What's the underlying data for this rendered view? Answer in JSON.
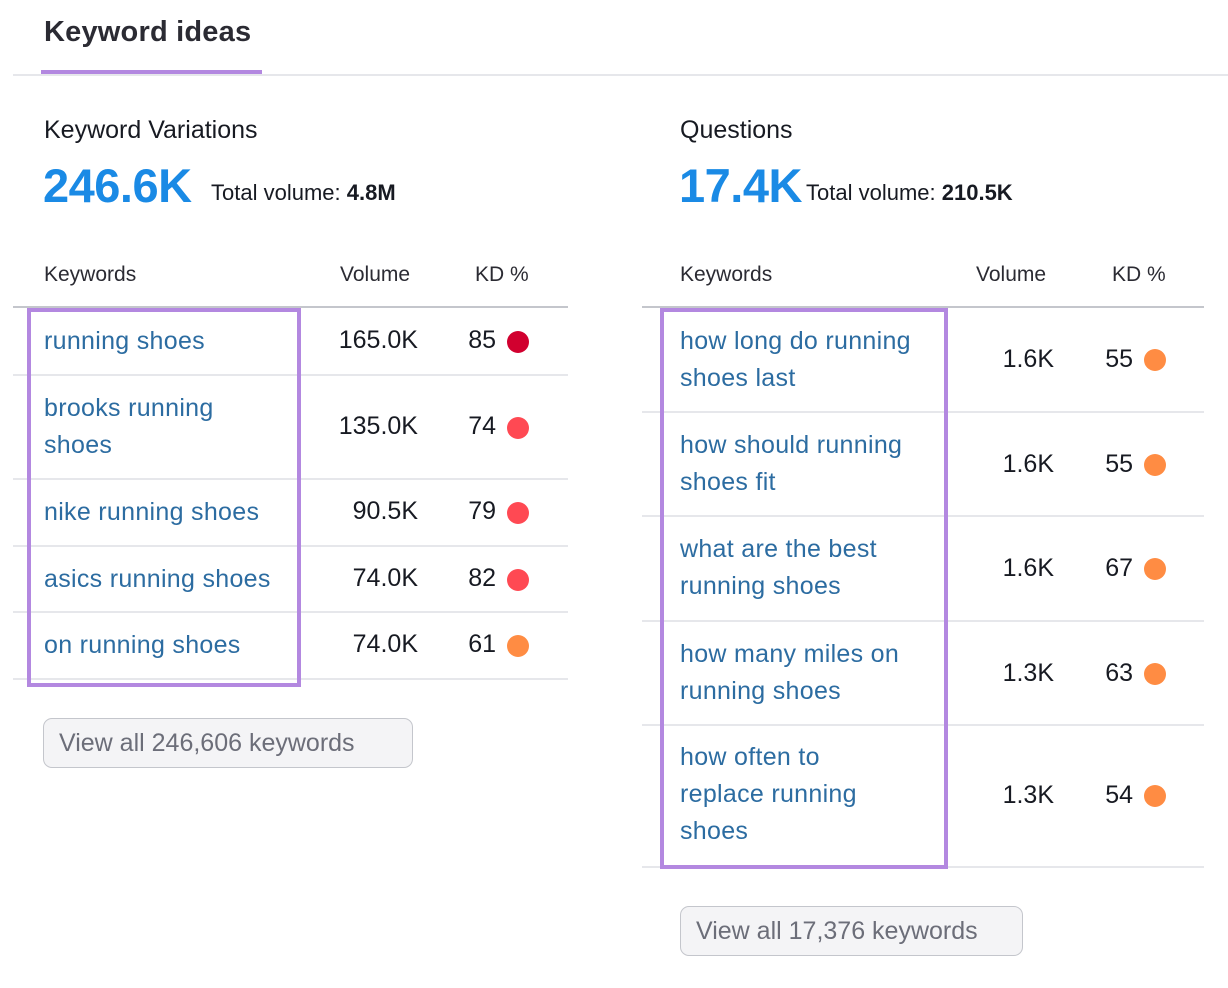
{
  "header": {
    "active_tab": "Keyword ideas"
  },
  "colors": {
    "accent_underline": "#b388e0",
    "big_number": "#1a8ae5",
    "link": "#2c6ca1",
    "kd_very_hard": "#d1002f",
    "kd_hard": "#ff4953",
    "kd_difficult": "#ff8c43"
  },
  "variations": {
    "title": "Keyword Variations",
    "count": "246.6K",
    "total_volume_label": "Total volume:",
    "total_volume_value": "4.8M",
    "columns": {
      "keywords": "Keywords",
      "volume": "Volume",
      "kd": "KD %"
    },
    "rows": [
      {
        "keyword": "running shoes",
        "volume": "165.0K",
        "kd": "85",
        "kd_level": "very-hard"
      },
      {
        "keyword": "brooks running shoes",
        "volume": "135.0K",
        "kd": "74",
        "kd_level": "hard"
      },
      {
        "keyword": "nike running shoes",
        "volume": "90.5K",
        "kd": "79",
        "kd_level": "hard"
      },
      {
        "keyword": "asics running shoes",
        "volume": "74.0K",
        "kd": "82",
        "kd_level": "hard"
      },
      {
        "keyword": "on running shoes",
        "volume": "74.0K",
        "kd": "61",
        "kd_level": "difficult"
      }
    ],
    "view_all_label": "View all 246,606 keywords"
  },
  "questions": {
    "title": "Questions",
    "count": "17.4K",
    "total_volume_label": "Total volume:",
    "total_volume_value": "210.5K",
    "columns": {
      "keywords": "Keywords",
      "volume": "Volume",
      "kd": "KD %"
    },
    "rows": [
      {
        "keyword": "how long do running shoes last",
        "volume": "1.6K",
        "kd": "55",
        "kd_level": "difficult"
      },
      {
        "keyword": "how should running shoes fit",
        "volume": "1.6K",
        "kd": "55",
        "kd_level": "difficult"
      },
      {
        "keyword": "what are the best running shoes",
        "volume": "1.6K",
        "kd": "67",
        "kd_level": "difficult"
      },
      {
        "keyword": "how many miles on running shoes",
        "volume": "1.3K",
        "kd": "63",
        "kd_level": "difficult"
      },
      {
        "keyword": "how often to replace running shoes",
        "volume": "1.3K",
        "kd": "54",
        "kd_level": "difficult"
      }
    ],
    "view_all_label": "View all 17,376 keywords"
  }
}
